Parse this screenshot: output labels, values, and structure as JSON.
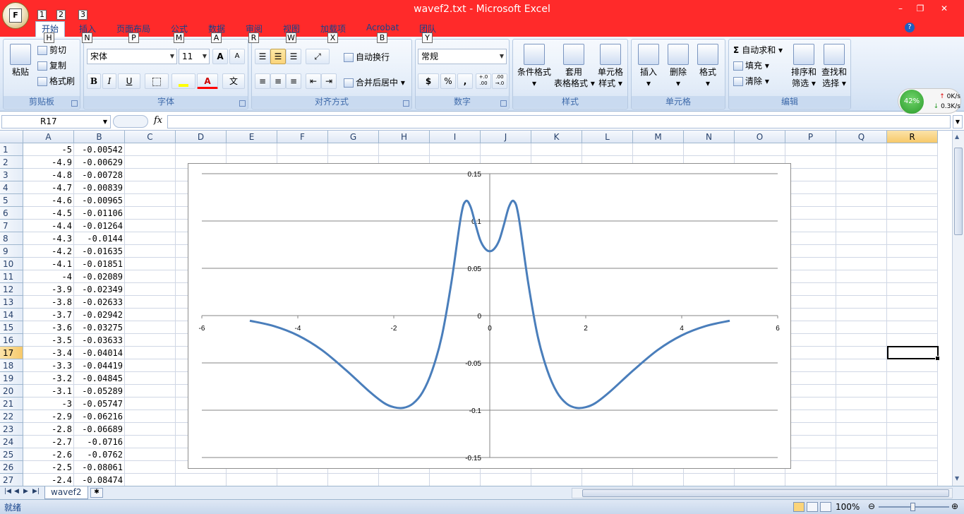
{
  "window": {
    "title": "wavef2.txt - Microsoft Excel",
    "minimize": "–",
    "restore": "❐",
    "close": "✕",
    "office_key": "F",
    "qat_keys": [
      "1",
      "2",
      "3"
    ]
  },
  "tabs": [
    {
      "label": "开始",
      "key": "H"
    },
    {
      "label": "插入",
      "key": "N"
    },
    {
      "label": "页面布局",
      "key": "P"
    },
    {
      "label": "公式",
      "key": "M"
    },
    {
      "label": "数据",
      "key": "A"
    },
    {
      "label": "审阅",
      "key": "R"
    },
    {
      "label": "视图",
      "key": "W"
    },
    {
      "label": "加载项",
      "key": "X"
    },
    {
      "label": "Acrobat",
      "key": "B"
    },
    {
      "label": "团队",
      "key": "Y"
    }
  ],
  "ribbon": {
    "clipboard": {
      "label": "剪贴板",
      "paste": "粘贴",
      "cut": "剪切",
      "copy": "复制",
      "format_painter": "格式刷"
    },
    "font": {
      "label": "字体",
      "name": "宋体",
      "size": "11",
      "grow": "A",
      "shrink": "A",
      "bold": "B",
      "italic": "I",
      "underline": "U",
      "font_color": "A",
      "phonetic": "文"
    },
    "alignment": {
      "label": "对齐方式",
      "wrap": "自动换行",
      "merge": "合并后居中"
    },
    "number": {
      "label": "数字",
      "format": "常规",
      "currency": "$",
      "percent": "%",
      "comma": ",",
      "inc_decimal": "+.0 .00",
      "dec_decimal": ".00 →.0"
    },
    "styles": {
      "label": "样式",
      "conditional": "条件格式",
      "table_1": "套用",
      "table_2": "表格格式",
      "cell_1": "单元格",
      "cell_2": "样式"
    },
    "cells": {
      "label": "单元格",
      "insert": "插入",
      "delete": "删除",
      "format": "格式"
    },
    "editing": {
      "label": "编辑",
      "autosum": "自动求和",
      "fill": "填充",
      "clear": "清除",
      "sort_1": "排序和",
      "sort_2": "筛选",
      "find_1": "查找和",
      "find_2": "选择"
    }
  },
  "network_widget": {
    "percent": "42%",
    "up": "0K/s",
    "down": "0.3K/s"
  },
  "formula_bar": {
    "name_box": "R17",
    "fx": "fx",
    "formula": ""
  },
  "columns": [
    "A",
    "B",
    "C",
    "D",
    "E",
    "F",
    "G",
    "H",
    "I",
    "J",
    "K",
    "L",
    "M",
    "N",
    "O",
    "P",
    "Q",
    "R"
  ],
  "selected_column": "R",
  "selected_row": "17",
  "rows": [
    {
      "n": "1",
      "a": "-5",
      "b": "-0.00542"
    },
    {
      "n": "2",
      "a": "-4.9",
      "b": "-0.00629"
    },
    {
      "n": "3",
      "a": "-4.8",
      "b": "-0.00728"
    },
    {
      "n": "4",
      "a": "-4.7",
      "b": "-0.00839"
    },
    {
      "n": "5",
      "a": "-4.6",
      "b": "-0.00965"
    },
    {
      "n": "6",
      "a": "-4.5",
      "b": "-0.01106"
    },
    {
      "n": "7",
      "a": "-4.4",
      "b": "-0.01264"
    },
    {
      "n": "8",
      "a": "-4.3",
      "b": "-0.0144"
    },
    {
      "n": "9",
      "a": "-4.2",
      "b": "-0.01635"
    },
    {
      "n": "10",
      "a": "-4.1",
      "b": "-0.01851"
    },
    {
      "n": "11",
      "a": "-4",
      "b": "-0.02089"
    },
    {
      "n": "12",
      "a": "-3.9",
      "b": "-0.02349"
    },
    {
      "n": "13",
      "a": "-3.8",
      "b": "-0.02633"
    },
    {
      "n": "14",
      "a": "-3.7",
      "b": "-0.02942"
    },
    {
      "n": "15",
      "a": "-3.6",
      "b": "-0.03275"
    },
    {
      "n": "16",
      "a": "-3.5",
      "b": "-0.03633"
    },
    {
      "n": "17",
      "a": "-3.4",
      "b": "-0.04014"
    },
    {
      "n": "18",
      "a": "-3.3",
      "b": "-0.04419"
    },
    {
      "n": "19",
      "a": "-3.2",
      "b": "-0.04845"
    },
    {
      "n": "20",
      "a": "-3.1",
      "b": "-0.05289"
    },
    {
      "n": "21",
      "a": "-3",
      "b": "-0.05747"
    },
    {
      "n": "22",
      "a": "-2.9",
      "b": "-0.06216"
    },
    {
      "n": "23",
      "a": "-2.8",
      "b": "-0.06689"
    },
    {
      "n": "24",
      "a": "-2.7",
      "b": "-0.0716"
    },
    {
      "n": "25",
      "a": "-2.6",
      "b": "-0.0762"
    },
    {
      "n": "26",
      "a": "-2.5",
      "b": "-0.08061"
    },
    {
      "n": "27",
      "a": "-2.4",
      "b": "-0.08474"
    }
  ],
  "chart_data": {
    "type": "scatter-smooth-line",
    "xlim": [
      -6,
      6
    ],
    "ylim": [
      -0.15,
      0.15
    ],
    "x_ticks": [
      "-6",
      "-4",
      "-2",
      "0",
      "2",
      "4",
      "6"
    ],
    "y_ticks": [
      "0.15",
      "0.1",
      "0.05",
      "0",
      "-0.05",
      "-0.1",
      "-0.15"
    ],
    "gridlines": "horizontal",
    "legend": "none",
    "series": [
      {
        "color": "#4a7ebb",
        "x": [
          -5,
          -4.5,
          -4,
          -3.5,
          -3,
          -2.5,
          -2.2,
          -2,
          -1.8,
          -1.6,
          -1.4,
          -1.2,
          -1,
          -0.8,
          -0.6,
          -0.5,
          -0.4,
          -0.3,
          -0.2,
          -0.1,
          0,
          0.1,
          0.2,
          0.3,
          0.4,
          0.5,
          0.6,
          0.8,
          1,
          1.2,
          1.4,
          1.6,
          1.8,
          2,
          2.2,
          2.5,
          3,
          3.5,
          4,
          4.5,
          5
        ],
        "y": [
          -0.00542,
          -0.01106,
          -0.02089,
          -0.03633,
          -0.05747,
          -0.08061,
          -0.0925,
          -0.0968,
          -0.0975,
          -0.093,
          -0.081,
          -0.058,
          -0.022,
          0.035,
          0.105,
          0.121,
          0.115,
          0.097,
          0.08,
          0.071,
          0.068,
          0.071,
          0.08,
          0.097,
          0.115,
          0.121,
          0.105,
          0.035,
          -0.022,
          -0.058,
          -0.081,
          -0.093,
          -0.0975,
          -0.0968,
          -0.0925,
          -0.08061,
          -0.05747,
          -0.03633,
          -0.02089,
          -0.01106,
          -0.00542
        ]
      }
    ]
  },
  "sheet_tab": "wavef2",
  "status": {
    "ready": "就绪",
    "zoom": "100%"
  }
}
